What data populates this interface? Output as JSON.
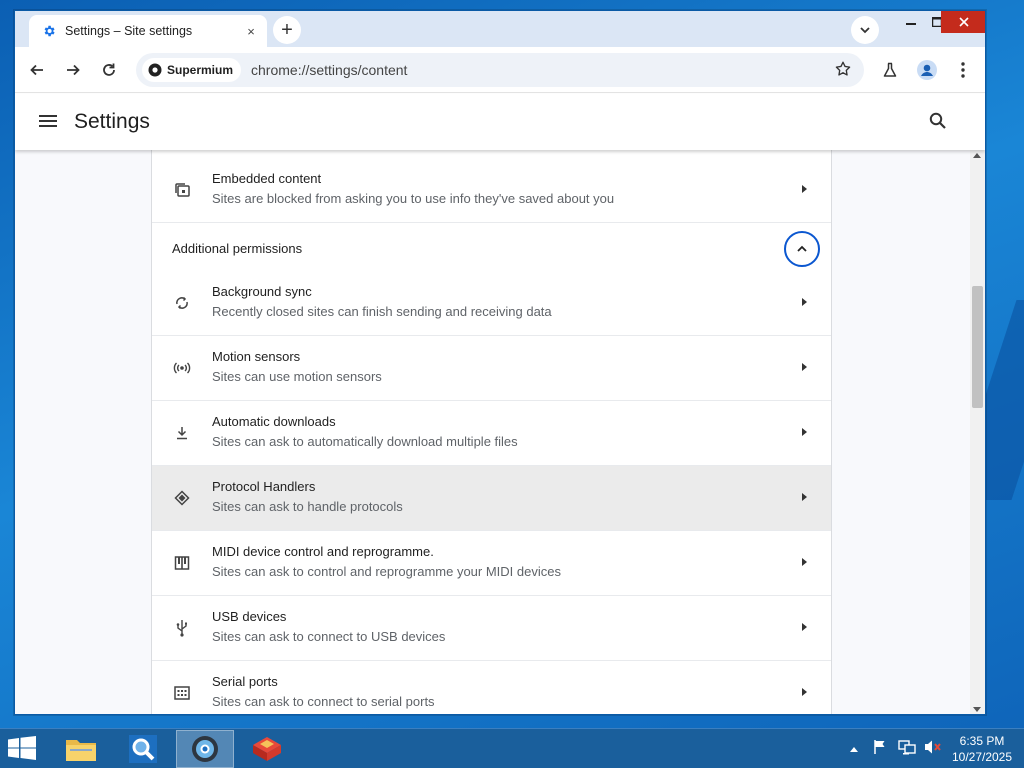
{
  "browser": {
    "tab_title": "Settings – Site settings",
    "tab_close": "×",
    "new_tab": "+",
    "site_chip": "Supermium",
    "url": "chrome://settings/content"
  },
  "settings": {
    "title": "Settings"
  },
  "rows_top": [
    {
      "title": "Embedded content",
      "subtitle": "Sites are blocked from asking you to use info they've saved about you"
    }
  ],
  "section": {
    "label": "Additional permissions"
  },
  "rows": [
    {
      "title": "Background sync",
      "subtitle": "Recently closed sites can finish sending and receiving data",
      "icon": "sync-icon"
    },
    {
      "title": "Motion sensors",
      "subtitle": "Sites can use motion sensors",
      "icon": "sensors-icon"
    },
    {
      "title": "Automatic downloads",
      "subtitle": "Sites can ask to automatically download multiple files",
      "icon": "download-icon"
    },
    {
      "title": "Protocol Handlers",
      "subtitle": "Sites can ask to handle protocols",
      "icon": "protocol-icon"
    },
    {
      "title": "MIDI device control and reprogramme.",
      "subtitle": "Sites can ask to control and reprogramme your MIDI devices",
      "icon": "piano-icon"
    },
    {
      "title": "USB devices",
      "subtitle": "Sites can ask to connect to USB devices",
      "icon": "usb-icon"
    },
    {
      "title": "Serial ports",
      "subtitle": "Sites can ask to connect to serial ports",
      "icon": "serial-port-icon"
    }
  ],
  "taskbar": {
    "time": "6:35 PM",
    "date": "10/27/2025"
  },
  "colors": {
    "accent": "#0b57d0",
    "hover_row": "#ebebeb",
    "taskbar": "#1a5f9c",
    "close_button": "#c42b1c"
  }
}
